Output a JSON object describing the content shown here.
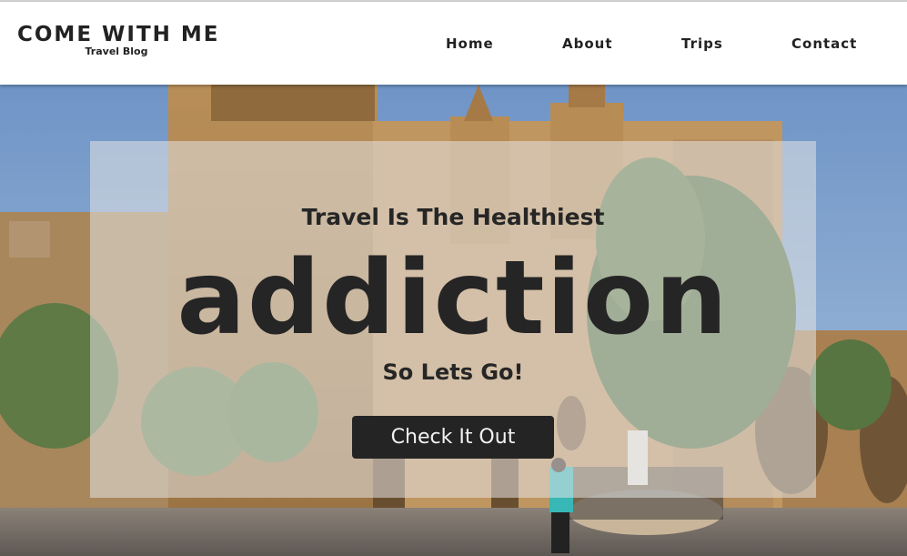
{
  "brand": {
    "title": "COME WITH ME",
    "subtitle": "Travel Blog"
  },
  "nav": [
    {
      "label": "Home"
    },
    {
      "label": "About"
    },
    {
      "label": "Trips"
    },
    {
      "label": "Contact"
    }
  ],
  "hero": {
    "tagline": "Travel Is The Healthiest",
    "headline": "addiction",
    "subline": "So Lets Go!",
    "cta_label": "Check It Out",
    "image": "church-square-photo"
  },
  "colors": {
    "text_dark": "#222222",
    "button_bg": "#242424",
    "button_text": "#f2f2f2",
    "overlay": "#e4e4e4"
  }
}
